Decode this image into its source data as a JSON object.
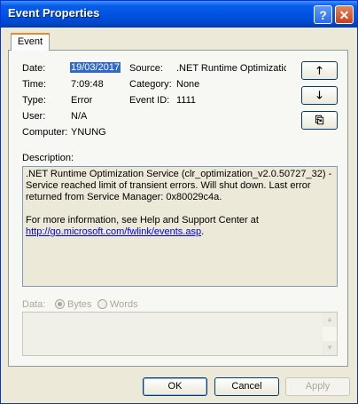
{
  "window": {
    "title": "Event Properties",
    "help_glyph": "?",
    "close_glyph": "✕"
  },
  "tab": {
    "label": "Event"
  },
  "fields": {
    "date_label": "Date:",
    "date_value": "19/03/2017",
    "time_label": "Time:",
    "time_value": "7:09:48",
    "type_label": "Type:",
    "type_value": "Error",
    "user_label": "User:",
    "user_value": "N/A",
    "computer_label": "Computer:",
    "computer_value": "YNUNG",
    "source_label": "Source:",
    "source_value": ".NET Runtime Optimizatic",
    "category_label": "Category:",
    "category_value": "None",
    "event_id_label": "Event ID:",
    "event_id_value": "1111"
  },
  "side_buttons": {
    "up_glyph": "🡑",
    "down_glyph": "🡓",
    "copy_glyph": "⎘"
  },
  "description": {
    "label": "Description:",
    "paragraph1": ".NET Runtime Optimization Service (clr_optimization_v2.0.50727_32) - Service reached limit of transient errors. Will shut down. Last error returned from Service Manager: 0x80029c4a.",
    "paragraph2_prefix": "For more information, see Help and Support Center at",
    "link": "http://go.microsoft.com/fwlink/events.asp",
    "paragraph2_suffix": "."
  },
  "data": {
    "label": "Data:",
    "bytes_label": "Bytes",
    "words_label": "Words",
    "selected": "Bytes"
  },
  "buttons": {
    "ok": "OK",
    "cancel": "Cancel",
    "apply": "Apply"
  },
  "colors": {
    "titlebar": "#0054e3",
    "dialog_bg": "#ece9d8",
    "selection": "#316ac5",
    "link": "#0000ee"
  }
}
